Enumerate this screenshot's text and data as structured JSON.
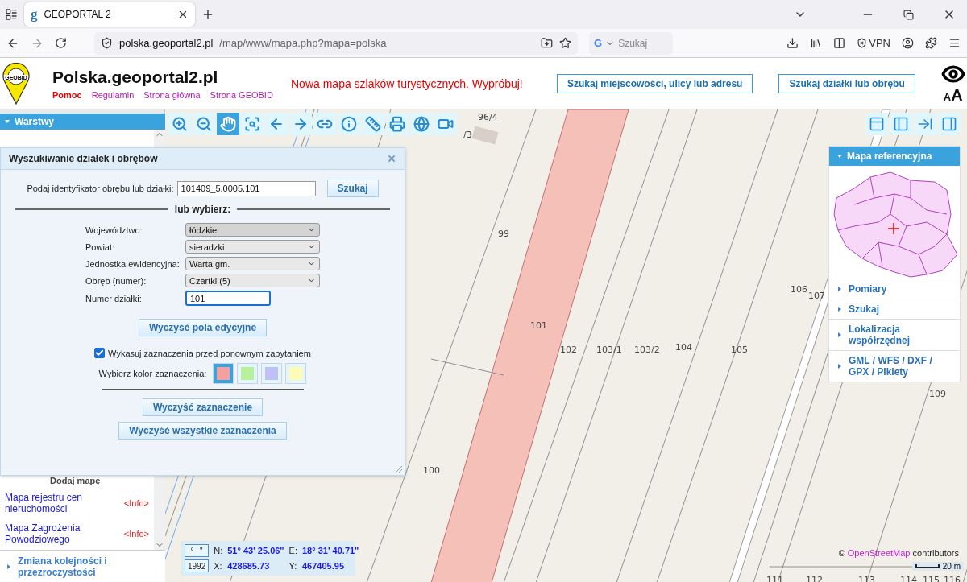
{
  "browser": {
    "tab_title": "GEOPORTAL 2",
    "favicon": "g",
    "url_host": "polska.geoportal2.pl",
    "url_path": "/map/www/mapa.php?mapa=polska",
    "search_placeholder": "Szukaj",
    "search_engine": "G",
    "vpn": "VPN"
  },
  "header": {
    "logo_text": "GEOBID",
    "site_title": "Polska.geoportal2.pl",
    "nav": [
      {
        "label": "Pomoc",
        "kind": "help"
      },
      {
        "label": "Regulamin",
        "kind": "link"
      },
      {
        "label": "Strona główna",
        "kind": "link"
      },
      {
        "label": "Strona GEOBID",
        "kind": "link"
      }
    ],
    "promo": "Nowa mapa szlaków turystycznych. Wypróbuj!",
    "buttons": [
      "Szukaj miejscowości, ulicy lub adresu",
      "Szukaj działki lub obrębu"
    ],
    "font_small": "A",
    "font_large": "A"
  },
  "sidebar": {
    "header": "Warstwy",
    "expanded": true,
    "hidden_label": "Dodaj mapę",
    "items": [
      {
        "title": "Mapa rejestru cen nieruchomości",
        "info": "<Info>"
      },
      {
        "title": "Mapa Zagrożenia Powodziowego",
        "info": "<Info>"
      }
    ],
    "section": "Zmiana kolejności i przezroczystości"
  },
  "toolbar": [
    {
      "kind": "zoom-in",
      "selected": false
    },
    {
      "kind": "zoom-out",
      "selected": false
    },
    {
      "kind": "pan",
      "selected": true
    },
    {
      "kind": "zoom-box",
      "selected": false
    },
    {
      "kind": "back",
      "selected": false
    },
    {
      "kind": "forward",
      "selected": false
    },
    {
      "kind": "link",
      "selected": false
    },
    {
      "kind": "info",
      "selected": false
    },
    {
      "kind": "measure",
      "selected": false
    },
    {
      "kind": "print",
      "selected": false
    },
    {
      "kind": "globe",
      "selected": false
    },
    {
      "kind": "video",
      "selected": false
    }
  ],
  "layout_buttons": [
    {
      "kind": "top"
    },
    {
      "kind": "left"
    },
    {
      "kind": "export"
    },
    {
      "kind": "right"
    }
  ],
  "dialog": {
    "title": "Wyszukiwanie działek i obrębów",
    "id_label": "Podaj identyfikator obrębu lub działki:",
    "id_value": "101409_5.0005.101",
    "search_button": "Szukaj",
    "divider": "lub wybierz:",
    "selects": [
      {
        "label": "Województwo:",
        "value": "łódzkie"
      },
      {
        "label": "Powiat:",
        "value": "sieradzki"
      },
      {
        "label": "Jednostka ewidencyjna:",
        "value": "Warta gm."
      },
      {
        "label": "Obręb (numer):",
        "value": "Czartki (5)"
      }
    ],
    "number_label": "Numer działki:",
    "number_value": "101",
    "clear_fields": "Wyczyść pola edycyjne",
    "checkbox": {
      "label": "Wykasuj zaznaczenia przed ponownym zapytaniem",
      "checked": true
    },
    "color_label": "Wybierz kolor zaznaczenia:",
    "colors": [
      {
        "color": "#f4a0a0",
        "selected": true
      },
      {
        "color": "#b8f0a0",
        "selected": false
      },
      {
        "color": "#c0c0f8",
        "selected": false
      },
      {
        "color": "#fcfcb8",
        "selected": false
      }
    ],
    "clear_selection": "Wyczyść zaznaczenie",
    "clear_all": "Wyczyść wszystkie zaznaczenia"
  },
  "map": {
    "labels": [
      "96/4",
      "/3",
      "99",
      "101",
      "102",
      "103/1",
      "103/2",
      "104",
      "105",
      "106",
      "107",
      "109",
      "100",
      "111",
      "112",
      "113",
      "114",
      "115",
      "116"
    ],
    "attribution": {
      "prefix": "©",
      "link": "OpenStreetMap",
      "suffix": "contributors"
    },
    "scale": "20 m"
  },
  "coords": {
    "dms_button": "° ' \"",
    "epsg_button": "1992",
    "n_label": "N:",
    "n_value": "51° 43' 25.06\"",
    "e_label": "E:",
    "e_value": "18° 31' 40.71\"",
    "x_label": "X:",
    "x_value": "428685.73",
    "y_label": "Y:",
    "y_value": "467405.95"
  },
  "right_panel": {
    "header": "Mapa referencyjna",
    "expanded": true,
    "items": [
      "Pomiary",
      "Szukaj",
      "Lokalizacja współrzędnej",
      "GML / WFS / DXF / GPX / Pikiety"
    ]
  }
}
